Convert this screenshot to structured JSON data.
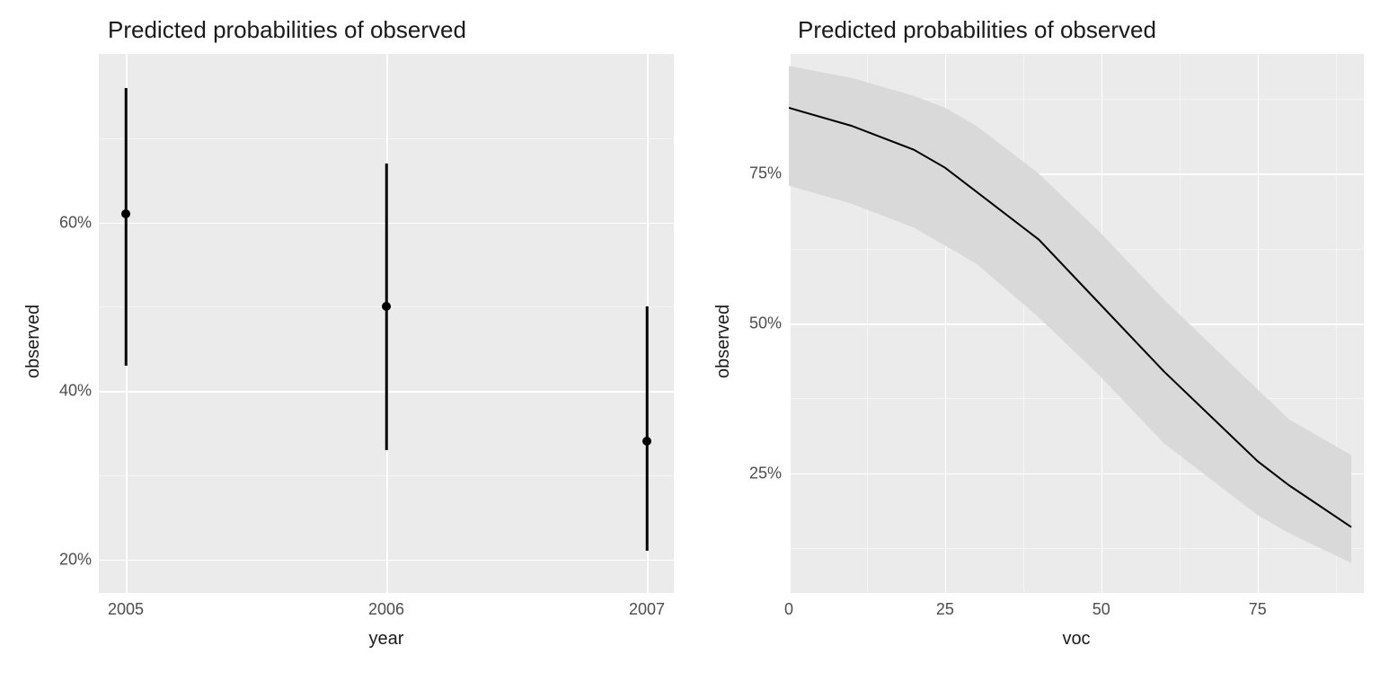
{
  "chart_data": [
    {
      "type": "scatter",
      "title": "Predicted probabilities of observed",
      "xlabel": "year",
      "ylabel": "observed",
      "categories": [
        "2005",
        "2006",
        "2007"
      ],
      "series": [
        {
          "name": "observed",
          "est": [
            61,
            50,
            34
          ],
          "low": [
            43,
            33,
            21
          ],
          "high": [
            76,
            67,
            50
          ]
        }
      ],
      "ylim": [
        20,
        80
      ],
      "yticks": [
        20,
        40,
        60
      ],
      "yticklabels": [
        "20%",
        "40%",
        "60%"
      ]
    },
    {
      "type": "line",
      "title": "Predicted probabilities of observed",
      "xlabel": "voc",
      "ylabel": "observed",
      "x": [
        0,
        10,
        20,
        25,
        30,
        40,
        50,
        60,
        70,
        75,
        80,
        90
      ],
      "y": [
        86,
        83,
        79,
        76,
        72,
        64,
        53,
        42,
        32,
        27,
        23,
        16
      ],
      "ribbon_low": [
        73,
        70,
        66,
        63,
        60,
        51,
        41,
        30,
        22,
        18,
        15,
        10
      ],
      "ribbon_high": [
        93,
        91,
        88,
        86,
        83,
        75,
        65,
        54,
        44,
        39,
        34,
        28
      ],
      "xlim": [
        0,
        92
      ],
      "ylim": [
        5,
        95
      ],
      "xticks": [
        0,
        25,
        50,
        75
      ],
      "yticks": [
        25,
        50,
        75
      ],
      "yticklabels": [
        "25%",
        "50%",
        "75%"
      ]
    }
  ]
}
